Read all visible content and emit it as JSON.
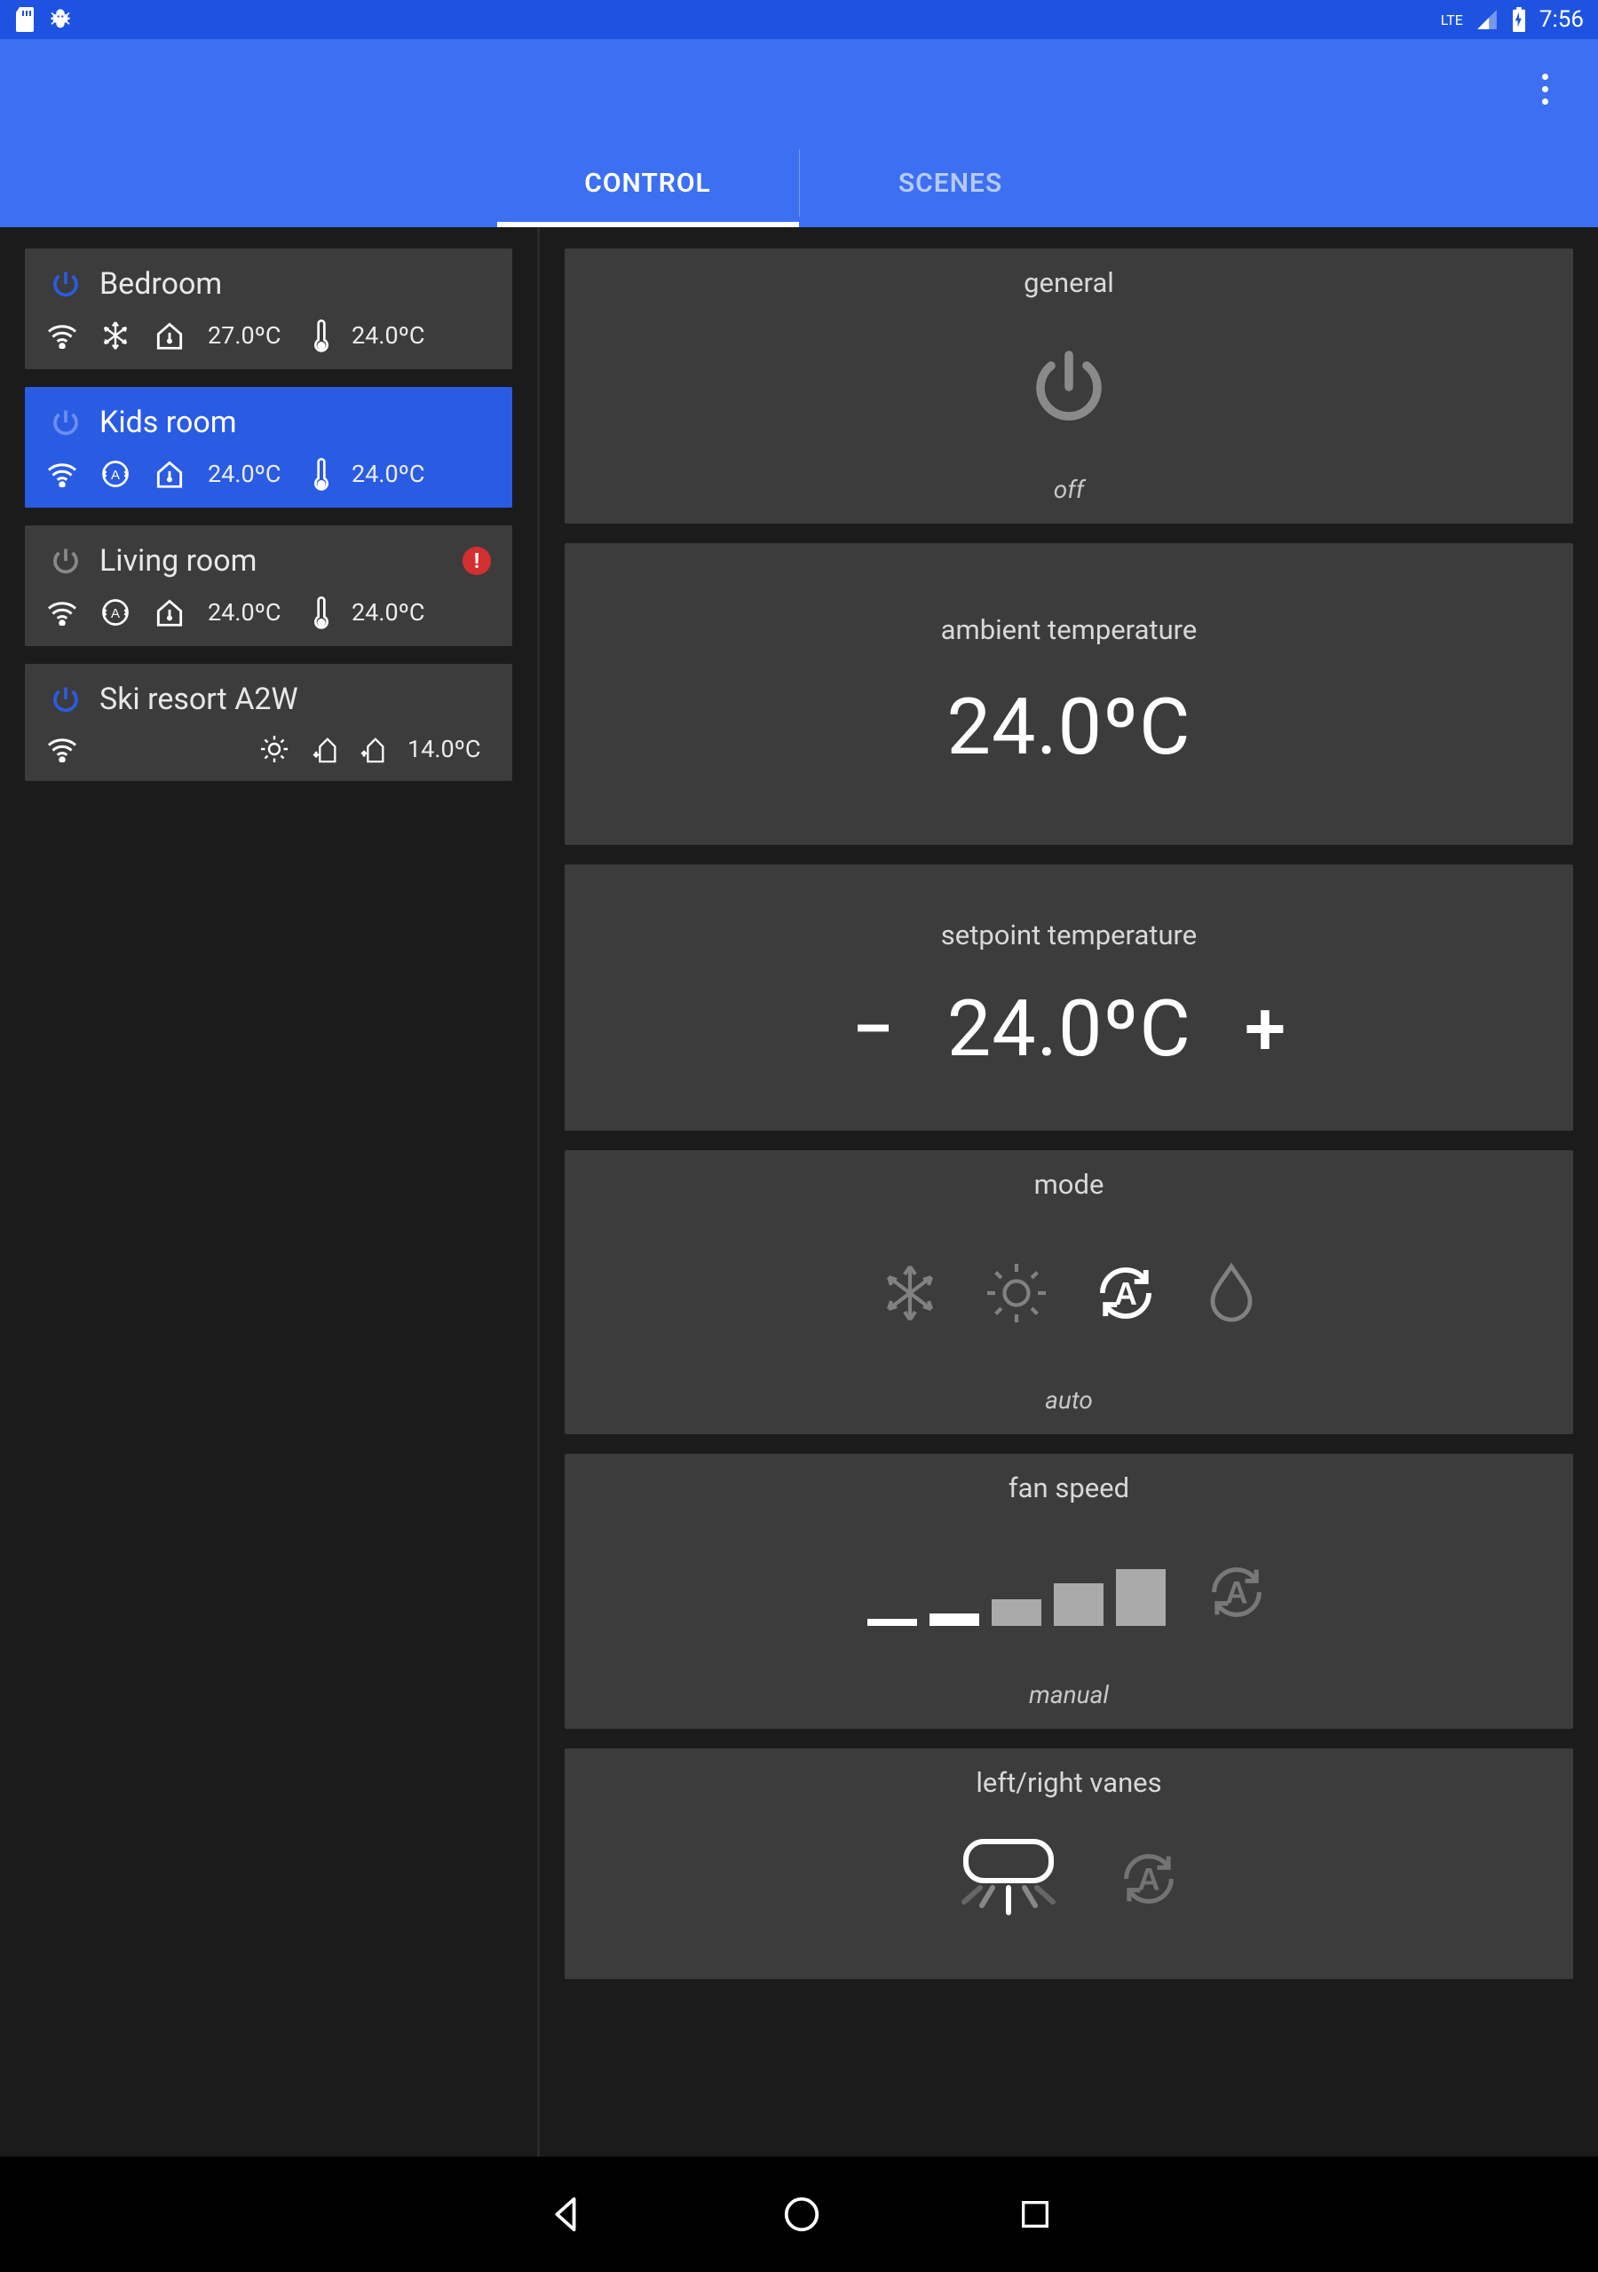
{
  "status": {
    "time": "7:56",
    "network": "LTE"
  },
  "tabs": {
    "control": "CONTROL",
    "scenes": "SCENES",
    "active": "control"
  },
  "rooms": [
    {
      "id": "bedroom",
      "name": "Bedroom",
      "power": "on",
      "mode": "cool",
      "setpoint": "27.0ºC",
      "ambient": "24.0ºC",
      "selected": false,
      "alert": false
    },
    {
      "id": "kids",
      "name": "Kids room",
      "power": "off",
      "mode": "auto",
      "setpoint": "24.0ºC",
      "ambient": "24.0ºC",
      "selected": true,
      "alert": false
    },
    {
      "id": "living",
      "name": "Living room",
      "power": "off",
      "mode": "auto",
      "setpoint": "24.0ºC",
      "ambient": "24.0ºC",
      "selected": false,
      "alert": true
    },
    {
      "id": "ski",
      "name": "Ski resort A2W",
      "power": "on",
      "mode": "heat",
      "setpoint": "",
      "ambient": "14.0ºC",
      "selected": false,
      "alert": false,
      "a2w": true
    }
  ],
  "panel": {
    "general": {
      "title": "general",
      "state": "off"
    },
    "ambient": {
      "title": "ambient temperature",
      "value": "24.0ºC"
    },
    "setpoint": {
      "title": "setpoint temperature",
      "value": "24.0ºC"
    },
    "mode": {
      "title": "mode",
      "state": "auto",
      "options": [
        "cool",
        "heat",
        "auto",
        "dry"
      ]
    },
    "fan": {
      "title": "fan speed",
      "state": "manual"
    },
    "vanes": {
      "title": "left/right vanes"
    }
  }
}
